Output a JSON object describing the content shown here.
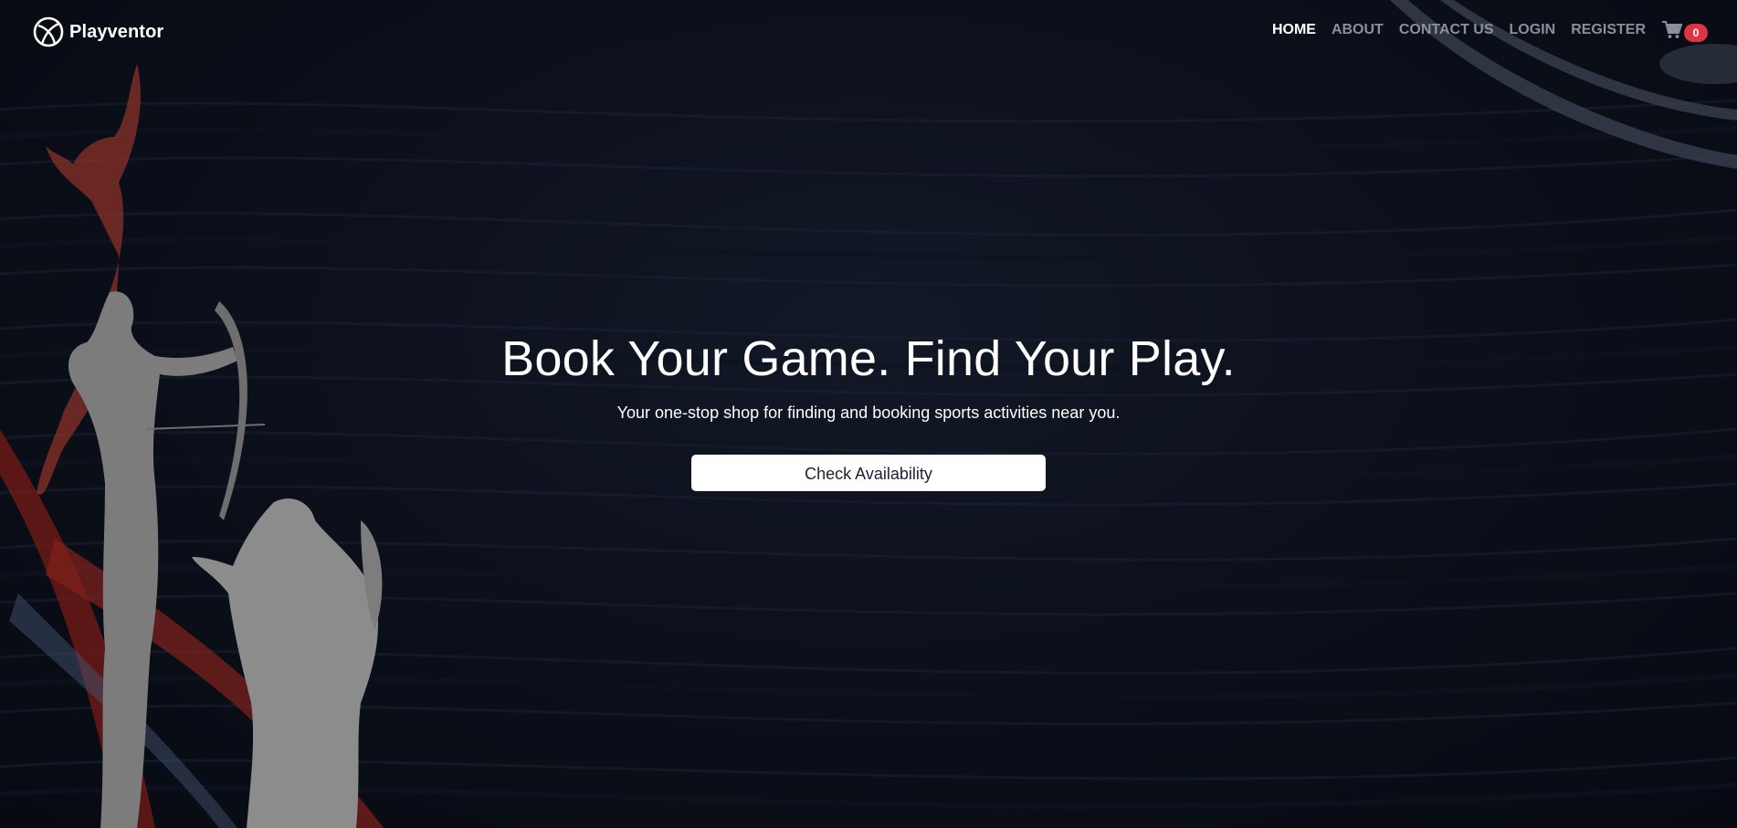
{
  "brand": {
    "name": "Playventor",
    "logo_icon": "volleyball-icon"
  },
  "nav": {
    "items": [
      {
        "label": "HOME",
        "active": true
      },
      {
        "label": "ABOUT",
        "active": false
      },
      {
        "label": "CONTACT US",
        "active": false
      },
      {
        "label": "LOGIN",
        "active": false
      },
      {
        "label": "REGISTER",
        "active": false
      }
    ],
    "cart_icon": "cart-icon",
    "cart_count": "0"
  },
  "hero": {
    "title": "Book Your Game. Find Your Play.",
    "subtitle": "Your one-stop shop for finding and booking sports activities near you.",
    "cta_label": "Check Availability"
  },
  "colors": {
    "background": "#0b0f19",
    "text_primary": "#ffffff",
    "nav_inactive": "#8a8f99",
    "badge": "#dc3545",
    "accent_red": "#b3261e"
  }
}
